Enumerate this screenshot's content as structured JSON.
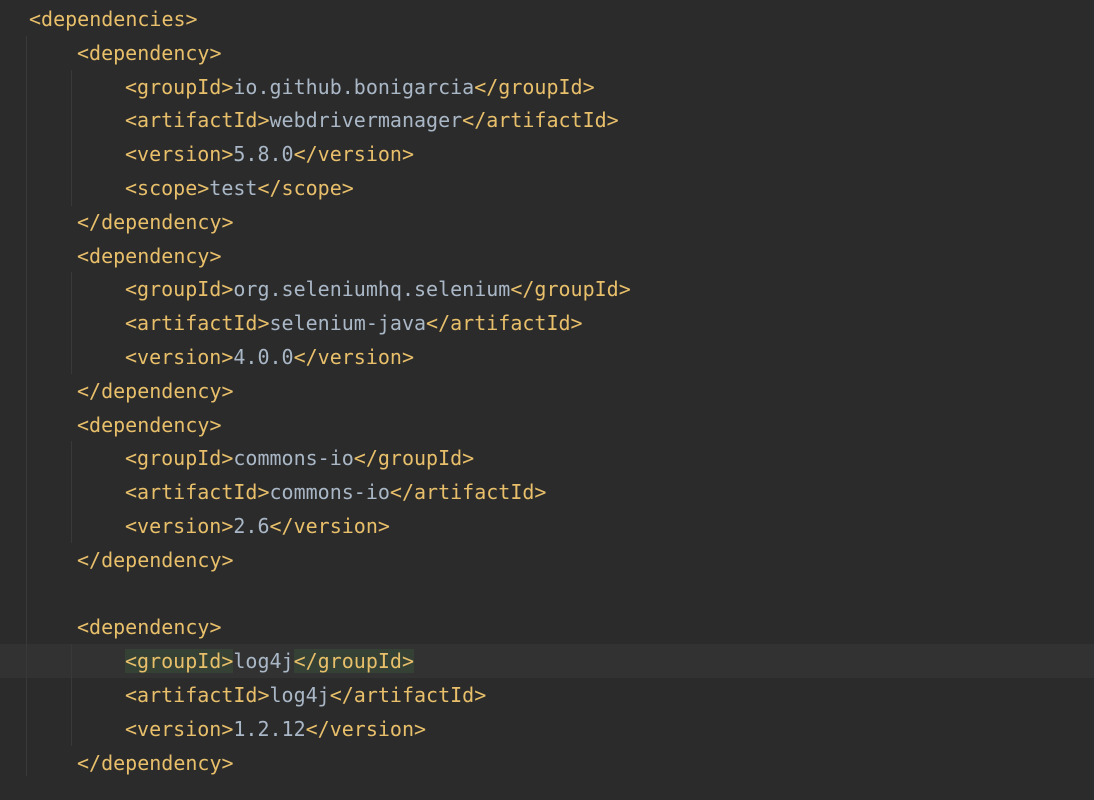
{
  "editor": {
    "language": "xml",
    "colors": {
      "background": "#2b2b2b",
      "tag": "#e8bf6a",
      "text": "#a9b7c6",
      "tag_match_highlight": "#344134",
      "current_line": "#323232",
      "indent_guide": "#393939"
    },
    "current_line": 19,
    "lines": [
      {
        "indent": 0,
        "open": "<dependencies>"
      },
      {
        "indent": 1,
        "open": "<dependency>"
      },
      {
        "indent": 2,
        "open": "<groupId>",
        "text": "io.github.bonigarcia",
        "close": "</groupId>"
      },
      {
        "indent": 2,
        "open": "<artifactId>",
        "text": "webdrivermanager",
        "close": "</artifactId>"
      },
      {
        "indent": 2,
        "open": "<version>",
        "text": "5.8.0",
        "close": "</version>"
      },
      {
        "indent": 2,
        "open": "<scope>",
        "text": "test",
        "close": "</scope>"
      },
      {
        "indent": 1,
        "open": "</dependency>"
      },
      {
        "indent": 1,
        "open": "<dependency>"
      },
      {
        "indent": 2,
        "open": "<groupId>",
        "text": "org.seleniumhq.selenium",
        "close": "</groupId>"
      },
      {
        "indent": 2,
        "open": "<artifactId>",
        "text": "selenium-java",
        "close": "</artifactId>"
      },
      {
        "indent": 2,
        "open": "<version>",
        "text": "4.0.0",
        "close": "</version>"
      },
      {
        "indent": 1,
        "open": "</dependency>"
      },
      {
        "indent": 1,
        "open": "<dependency>"
      },
      {
        "indent": 2,
        "open": "<groupId>",
        "text": "commons-io",
        "close": "</groupId>"
      },
      {
        "indent": 2,
        "open": "<artifactId>",
        "text": "commons-io",
        "close": "</artifactId>"
      },
      {
        "indent": 2,
        "open": "<version>",
        "text": "2.6",
        "close": "</version>"
      },
      {
        "indent": 1,
        "open": "</dependency>"
      },
      {
        "indent": 0,
        "open": ""
      },
      {
        "indent": 1,
        "open": "<dependency>"
      },
      {
        "indent": 2,
        "open": "<groupId>",
        "text": "log4j",
        "close": "</groupId>",
        "highlight": true
      },
      {
        "indent": 2,
        "open": "<artifactId>",
        "text": "log4j",
        "close": "</artifactId>"
      },
      {
        "indent": 2,
        "open": "<version>",
        "text": "1.2.12",
        "close": "</version>"
      },
      {
        "indent": 1,
        "open": "</dependency>"
      }
    ]
  }
}
